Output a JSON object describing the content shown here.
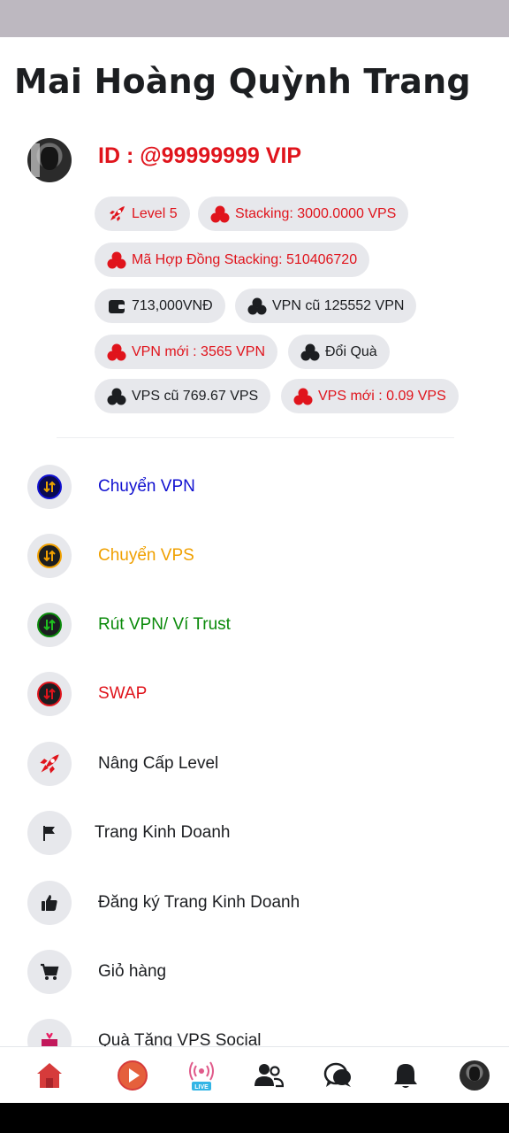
{
  "header": {
    "title": "Mai Hoàng Quỳnh Trang"
  },
  "profile": {
    "id_text": "ID : @99999999 VIP"
  },
  "chips": [
    {
      "label": "Level 5",
      "icon": "rocket-icon",
      "color": "#e0141c"
    },
    {
      "label": "Stacking: 3000.0000 VPS",
      "icon": "coins-icon",
      "color": "#e0141c"
    },
    {
      "label": "Mã Hợp Đồng Stacking: 510406720",
      "icon": "coins-icon",
      "color": "#e0141c"
    },
    {
      "label": "713,000VNĐ",
      "icon": "wallet-icon",
      "color": "#1c1e21"
    },
    {
      "label": "VPN cũ 125552 VPN",
      "icon": "coins-icon",
      "color": "#1c1e21"
    },
    {
      "label": "VPN mới : 3565 VPN",
      "icon": "coins-icon",
      "color": "#e0141c"
    },
    {
      "label": "Đổi Quà",
      "icon": "coins-icon",
      "color": "#1c1e21"
    },
    {
      "label": "VPS cũ 769.67 VPS",
      "icon": "coins-icon",
      "color": "#1c1e21"
    },
    {
      "label": "VPS mới : 0.09 VPS",
      "icon": "coins-icon",
      "color": "#e0141c"
    }
  ],
  "menu": [
    {
      "label": "Chuyển VPN",
      "icon": "swap-icon",
      "color": "#1010d0"
    },
    {
      "label": "Chuyển VPS",
      "icon": "swap-icon",
      "color": "#f0a000"
    },
    {
      "label": "Rút VPN/ Ví Trust",
      "icon": "swap-icon",
      "color": "#0a8a0a"
    },
    {
      "label": "SWAP",
      "icon": "swap-icon",
      "color": "#e0141c"
    },
    {
      "label": "Nâng Cấp Level",
      "icon": "rocket-icon",
      "color": "#1c1e21"
    },
    {
      "label": "Trang Kinh Doanh",
      "icon": "flag-icon",
      "color": "#1c1e21"
    },
    {
      "label": "Đăng ký Trang Kinh Doanh",
      "icon": "thumbs-up-icon",
      "color": "#1c1e21"
    },
    {
      "label": "Giỏ hàng",
      "icon": "cart-icon",
      "color": "#1c1e21"
    },
    {
      "label": "Quà Tặng VPS Social",
      "icon": "gift-icon",
      "color": "#1c1e21"
    }
  ],
  "bottom_nav": {
    "items": [
      "home-icon",
      "play-video-icon",
      "live-icon",
      "friends-icon",
      "chat-icon",
      "bell-icon",
      "profile-avatar"
    ],
    "live_badge": "LIVE",
    "home_color": "#d63b3b"
  }
}
